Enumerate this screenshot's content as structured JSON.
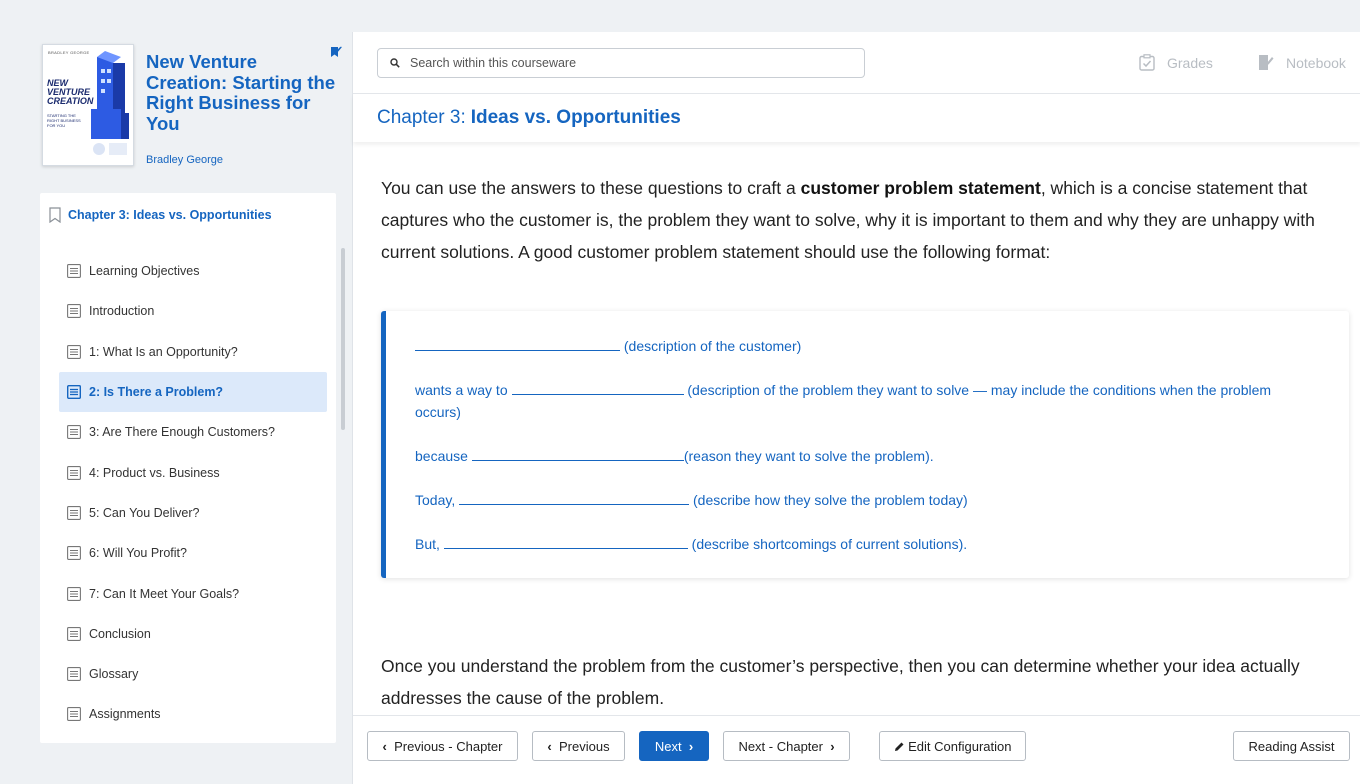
{
  "book": {
    "title": "New Venture Creation: Starting the Right Business for You",
    "author": "Bradley George",
    "cover": {
      "author_text": "BRADLEY GEORGE",
      "title_line1": "NEW",
      "title_line2": "VENTURE",
      "title_line3": "CREATION",
      "subtitle": "STARTING THE RIGHT BUSINESS FOR YOU"
    }
  },
  "toc": {
    "chapter": "Chapter 3: Ideas vs. Opportunities",
    "items": [
      {
        "label": "Learning Objectives"
      },
      {
        "label": "Introduction"
      },
      {
        "label": "1: What Is an Opportunity?"
      },
      {
        "label": "2: Is There a Problem?"
      },
      {
        "label": "3: Are There Enough Customers?"
      },
      {
        "label": "4: Product vs. Business"
      },
      {
        "label": "5: Can You Deliver?"
      },
      {
        "label": "6: Will You Profit?"
      },
      {
        "label": "7: Can It Meet Your Goals?"
      },
      {
        "label": "Conclusion"
      },
      {
        "label": "Glossary"
      },
      {
        "label": "Assignments"
      }
    ],
    "active_index": 3
  },
  "topbar": {
    "search_placeholder": "Search within this courseware",
    "grades_label": "Grades",
    "notebook_label": "Notebook"
  },
  "chapter_header": {
    "prefix": "Chapter 3:",
    "title": "Ideas vs. Opportunities"
  },
  "content": {
    "para1_before": "You can use the answers to these questions to craft a ",
    "para1_bold": "customer problem statement",
    "para1_after": ", which is a concise statement that captures who the customer is, the problem they want to solve, why it is important to them and why they are unhappy with current solutions. A good customer problem statement should use the following format:",
    "template": {
      "line1_after": " (description of the customer)",
      "line2_before": "wants a way to ",
      "line2_after": " (description of the problem they want to solve — may include the conditions when the problem occurs)",
      "line3_before": "because ",
      "line3_after": "(reason they want to solve the problem).",
      "line4_before": "Today, ",
      "line4_after": " (describe how they solve the problem today)",
      "line5_before": "But, ",
      "line5_after": " (describe shortcomings of current solutions)."
    },
    "para2": "Once you understand the problem from the customer’s perspective, then you can determine whether your idea actually addresses the cause of the problem."
  },
  "footer": {
    "prev_chapter": "Previous - Chapter",
    "previous": "Previous",
    "next": "Next",
    "next_chapter": "Next - Chapter",
    "edit_config": "Edit Configuration",
    "reading_assist": "Reading Assist"
  },
  "colors": {
    "accent": "#1565c0",
    "active_bg": "#dce9fa",
    "page_bg": "#eef1f4"
  },
  "icons": [
    "bookmark-icon",
    "document-icon",
    "search-icon",
    "grades-icon",
    "notebook-icon",
    "chevron-left-icon",
    "chevron-right-icon",
    "pencil-icon"
  ]
}
